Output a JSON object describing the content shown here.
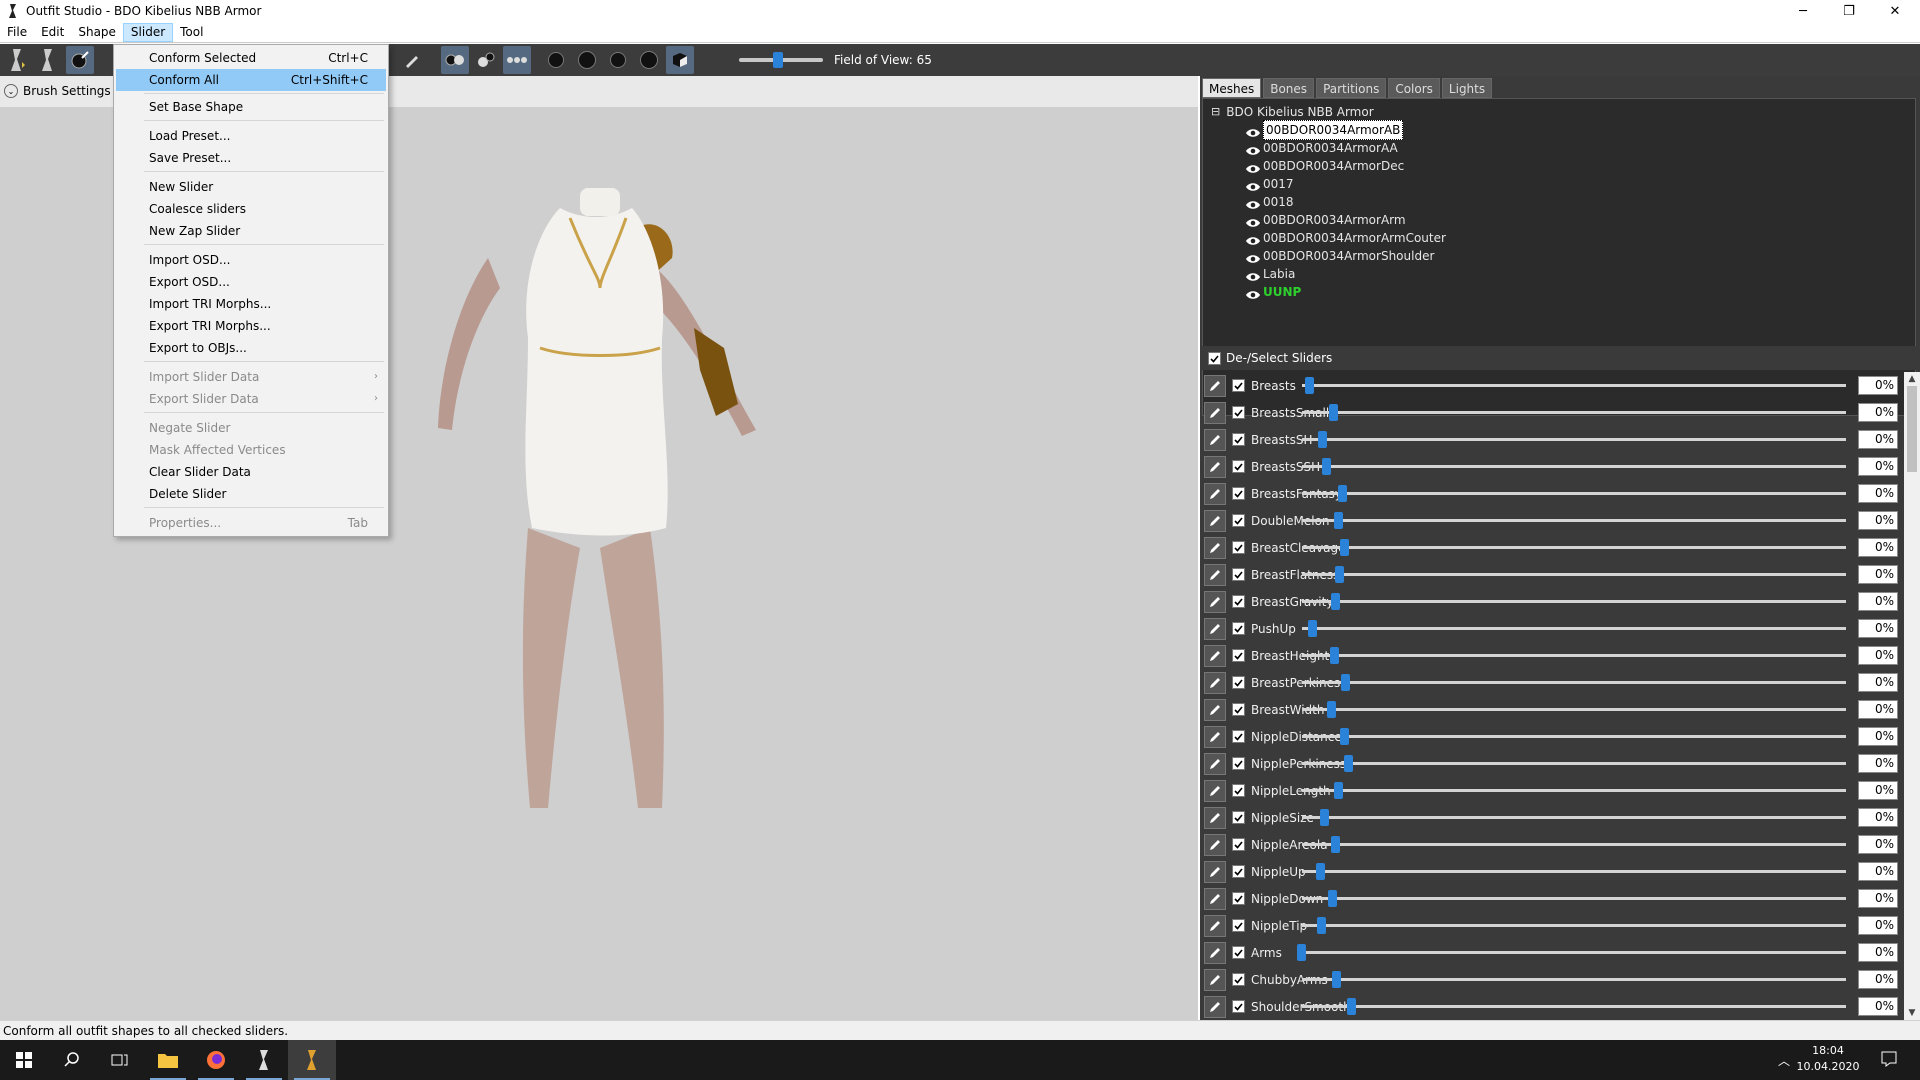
{
  "window": {
    "title": "Outfit Studio - BDO Kibelius NBB Armor",
    "minimize": "─",
    "maximize": "❐",
    "close": "✕"
  },
  "menubar": {
    "items": [
      "File",
      "Edit",
      "Shape",
      "Slider",
      "Tool"
    ],
    "active": "Slider"
  },
  "toolbar": {
    "fov_label": "Field of View: 65",
    "fov_value": 65
  },
  "brush": {
    "label": "Brush Settings"
  },
  "slider_menu": {
    "items": [
      {
        "label": "Conform Selected",
        "shortcut": "Ctrl+C"
      },
      {
        "label": "Conform All",
        "shortcut": "Ctrl+Shift+C",
        "selected": true
      },
      {
        "label": "Set Base Shape"
      },
      {
        "label": "Load Preset..."
      },
      {
        "label": "Save Preset..."
      },
      {
        "label": "New Slider"
      },
      {
        "label": "Coalesce sliders"
      },
      {
        "label": "New Zap Slider"
      },
      {
        "label": "Import OSD..."
      },
      {
        "label": "Export OSD..."
      },
      {
        "label": "Import TRI Morphs..."
      },
      {
        "label": "Export TRI Morphs..."
      },
      {
        "label": "Export to OBJs..."
      },
      {
        "label": "Import Slider Data",
        "disabled": true,
        "submenu": true
      },
      {
        "label": "Export Slider Data",
        "disabled": true,
        "submenu": true
      },
      {
        "label": "Negate Slider",
        "disabled": true
      },
      {
        "label": "Mask Affected Vertices",
        "disabled": true
      },
      {
        "label": "Clear Slider Data"
      },
      {
        "label": "Delete Slider"
      },
      {
        "label": "Properties...",
        "shortcut": "Tab",
        "disabled": true
      }
    ]
  },
  "panel_tabs": [
    "Meshes",
    "Bones",
    "Partitions",
    "Colors",
    "Lights"
  ],
  "mesh_tree": {
    "root": "BDO Kibelius NBB Armor",
    "root_toggle": "⊟",
    "items": [
      {
        "name": "00BDOR0034ArmorAB",
        "selected": true
      },
      {
        "name": "00BDOR0034ArmorAA"
      },
      {
        "name": "00BDOR0034ArmorDec"
      },
      {
        "name": "0017"
      },
      {
        "name": "0018"
      },
      {
        "name": "00BDOR0034ArmorArm"
      },
      {
        "name": "00BDOR0034ArmorArmCouter"
      },
      {
        "name": "00BDOR0034ArmorShoulder"
      },
      {
        "name": "Labia"
      },
      {
        "name": "UUNP",
        "reference": true
      }
    ]
  },
  "sliders_header": "De-/Select Sliders",
  "sliders": [
    {
      "name": "Breasts",
      "value": "0%",
      "pos": 0
    },
    {
      "name": "BreastsSmall",
      "value": "0%",
      "pos": 0
    },
    {
      "name": "BreastsSH",
      "value": "0%",
      "pos": 0
    },
    {
      "name": "BreastsSSH",
      "value": "0%",
      "pos": 0
    },
    {
      "name": "BreastsFantasy",
      "value": "0%",
      "pos": 0
    },
    {
      "name": "DoubleMelon",
      "value": "0%",
      "pos": 0
    },
    {
      "name": "BreastCleavage",
      "value": "0%",
      "pos": 0
    },
    {
      "name": "BreastFlatness",
      "value": "0%",
      "pos": 0
    },
    {
      "name": "BreastGravity",
      "value": "0%",
      "pos": 0
    },
    {
      "name": "PushUp",
      "value": "0%",
      "pos": 0
    },
    {
      "name": "BreastHeight",
      "value": "0%",
      "pos": 0
    },
    {
      "name": "BreastPerkiness",
      "value": "0%",
      "pos": 0
    },
    {
      "name": "BreastWidth",
      "value": "0%",
      "pos": 0
    },
    {
      "name": "NippleDistance",
      "value": "0%",
      "pos": 0
    },
    {
      "name": "NipplePerkiness",
      "value": "0%",
      "pos": 0
    },
    {
      "name": "NippleLength",
      "value": "0%",
      "pos": 0
    },
    {
      "name": "NippleSize",
      "value": "0%",
      "pos": 0
    },
    {
      "name": "NippleAreola",
      "value": "0%",
      "pos": 0
    },
    {
      "name": "NippleUp",
      "value": "0%",
      "pos": 0
    },
    {
      "name": "NippleDown",
      "value": "0%",
      "pos": 0
    },
    {
      "name": "NippleTip",
      "value": "0%",
      "pos": 0
    },
    {
      "name": "Arms",
      "value": "0%",
      "pos": 0
    },
    {
      "name": "ChubbyArms",
      "value": "0%",
      "pos": 0
    },
    {
      "name": "ShoulderSmooth",
      "value": "0%",
      "pos": 0
    }
  ],
  "status": "Conform all outfit shapes to all checked sliders.",
  "clock": {
    "time": "18:04",
    "date": "10.04.2020"
  },
  "colors": {
    "accent": "#2b82d9",
    "selection": "#91c9f7",
    "reference_mesh": "#2ed02e"
  }
}
